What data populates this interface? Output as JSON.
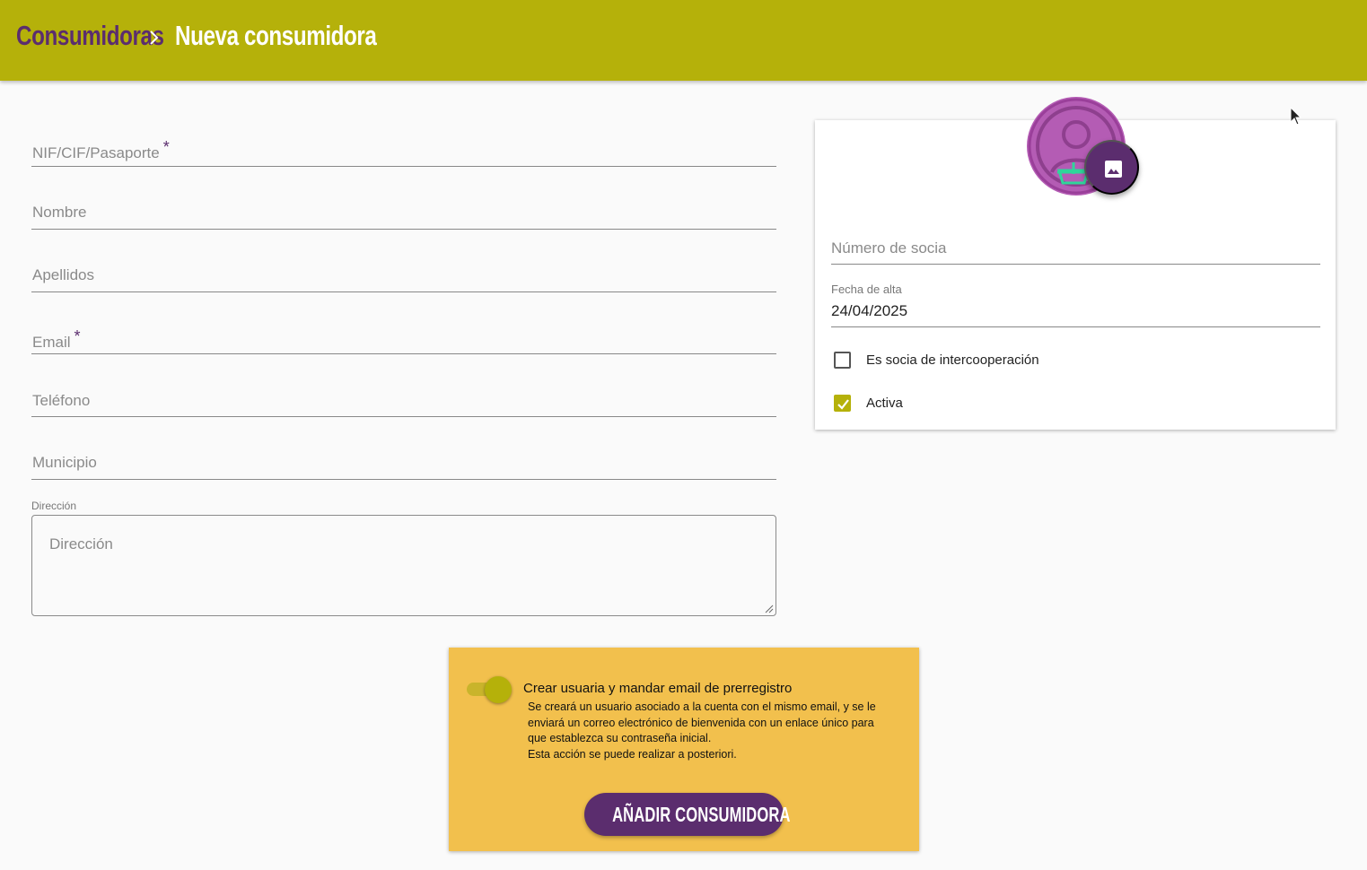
{
  "breadcrumb": {
    "root": "Consumidoras",
    "current": "Nueva consumidora",
    "separator_icon": "chevron-right-icon"
  },
  "form": {
    "nif_placeholder": "NIF/CIF/Pasaporte",
    "nif_required": "*",
    "nombre_placeholder": "Nombre",
    "apellidos_placeholder": "Apellidos",
    "email_placeholder": "Email",
    "email_required": "*",
    "telefono_placeholder": "Teléfono",
    "municipio_placeholder": "Municipio",
    "direccion_label": "Dirección",
    "direccion_placeholder": "Dirección"
  },
  "card": {
    "avatar_icon": "user-basket-icon",
    "image_button_icon": "image-icon",
    "numero_socia_placeholder": "Número de socia",
    "fecha_alta_label": "Fecha de alta",
    "fecha_alta_value": "24/04/2025",
    "intercooperacion_label": "Es socia de intercooperación",
    "intercooperacion_checked": false,
    "activa_label": "Activa",
    "activa_checked": true
  },
  "preregistro": {
    "toggle_on": true,
    "title": "Crear usuaria y mandar email de prerregistro",
    "desc_line1": "Se creará un usuario asociado a la cuenta con el mismo email, y se le",
    "desc_line2": "enviará un correo electrónico de bienvenida con un enlace único para",
    "desc_line3": "que establezca su contraseña inicial.",
    "desc_line4": "Esta acción se puede realizar a posteriori.",
    "button_label": "AÑADIR CONSUMIDORA"
  },
  "colors": {
    "topbar": "#b5b10a",
    "brand_purple": "#5b2d6e",
    "panel": "#f2c04d",
    "avatar": "#b45cb4"
  }
}
